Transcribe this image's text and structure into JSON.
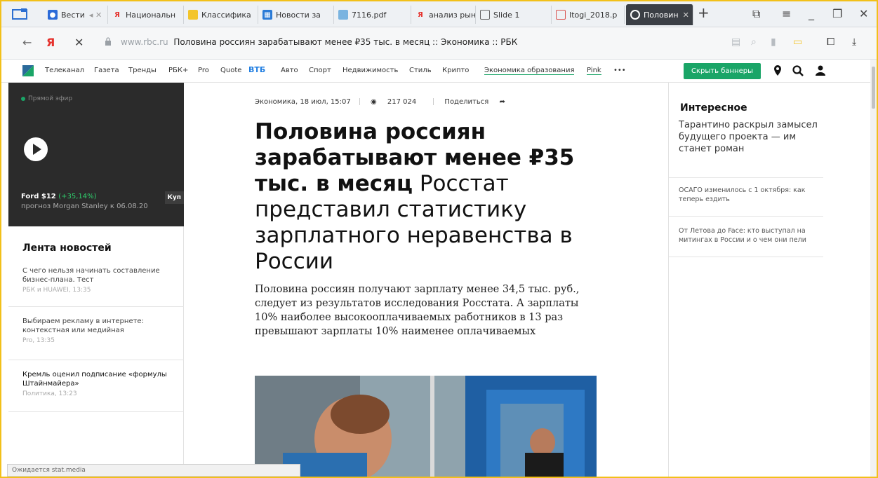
{
  "browser": {
    "tabs": [
      {
        "label": "Вести",
        "icon": "vesti-icon",
        "color": "#2a6ad8"
      },
      {
        "label": "Национальн",
        "icon": "yandex-icon",
        "color": "#e5322d"
      },
      {
        "label": "Классифика",
        "icon": "doc-icon",
        "color": "#f3c52a"
      },
      {
        "label": "Новости за",
        "icon": "news-icon",
        "color": "#2b7bd6"
      },
      {
        "label": "7116.pdf",
        "icon": "pdf-icon",
        "color": "#7ab4e0"
      },
      {
        "label": "анализ рын",
        "icon": "yandex-icon",
        "color": "#e5322d"
      },
      {
        "label": "Slide 1",
        "icon": "page-icon",
        "color": "#666666"
      },
      {
        "label": "Itogi_2018.p",
        "icon": "pdf-icon",
        "color": "#d9534f"
      },
      {
        "label": "Половин",
        "icon": "rbc-icon",
        "color": "#3b3f45"
      }
    ],
    "new_tab": "+",
    "address": {
      "domain": "www.rbc.ru",
      "title": "Половина россиян зарабатывают менее ₽35 тыс. в месяц :: Экономика :: РБК"
    },
    "status": "Ожидается stat.media"
  },
  "site_nav": {
    "items": [
      "Телеканал",
      "Газета",
      "Тренды",
      "РБК+",
      "Pro",
      "Quote",
      "ВТБ",
      "Авто",
      "Спорт",
      "Недвижимость",
      "Стиль",
      "Крипто",
      "Экономика образования",
      "Pink",
      "•••"
    ],
    "hide_banners": "Скрыть баннеры"
  },
  "live": {
    "tag": "Прямой эфир",
    "stock_name": "Ford $12",
    "stock_change": "(+35,14%)",
    "forecast": "прогноз Morgan Stanley к 06.08.20",
    "buy": "Куп"
  },
  "feed": {
    "title": "Лента новостей",
    "items": [
      {
        "text": "С чего нельзя начинать составление бизнес-плана. Тест",
        "meta": "РБК и HUAWEI, 13:35"
      },
      {
        "text": "Выбираем рекламу в интернете: контекстная или медийная",
        "meta": "Pro, 13:35"
      },
      {
        "text": "Кремль оценил подписание «формулы Штайнмайера»",
        "meta": "Политика, 13:23"
      }
    ]
  },
  "article": {
    "rubric_date": "Экономика, 18 июл, 15:07",
    "views": "217 024",
    "share": "Поделиться",
    "headline_bold": "Половина россиян зарабатывают менее ₽35 тыс. в месяц",
    "headline_rest": " Росстат представил статистику зарплатного неравенства в России",
    "lead": "Половина россиян получают зарплату менее 34,5 тыс. руб., следует из результатов исследования Росстата. А зарплаты 10% наиболее высокооплачиваемых работников в 13 раз превышают зарплаты 10% наименее оплачиваемых"
  },
  "sidebar": {
    "title": "Интересное",
    "items": [
      "Тарантино раскрыл замысел будущего проекта — им станет роман",
      "ОСАГО изменилось с 1 октября: как теперь ездить",
      "От Летова до Face: кто выступал на митингах в России и о чем они пели"
    ]
  },
  "colors": {
    "accent": "#1aa567",
    "frame": "#f2c019",
    "vtb": "#1f7de1"
  }
}
